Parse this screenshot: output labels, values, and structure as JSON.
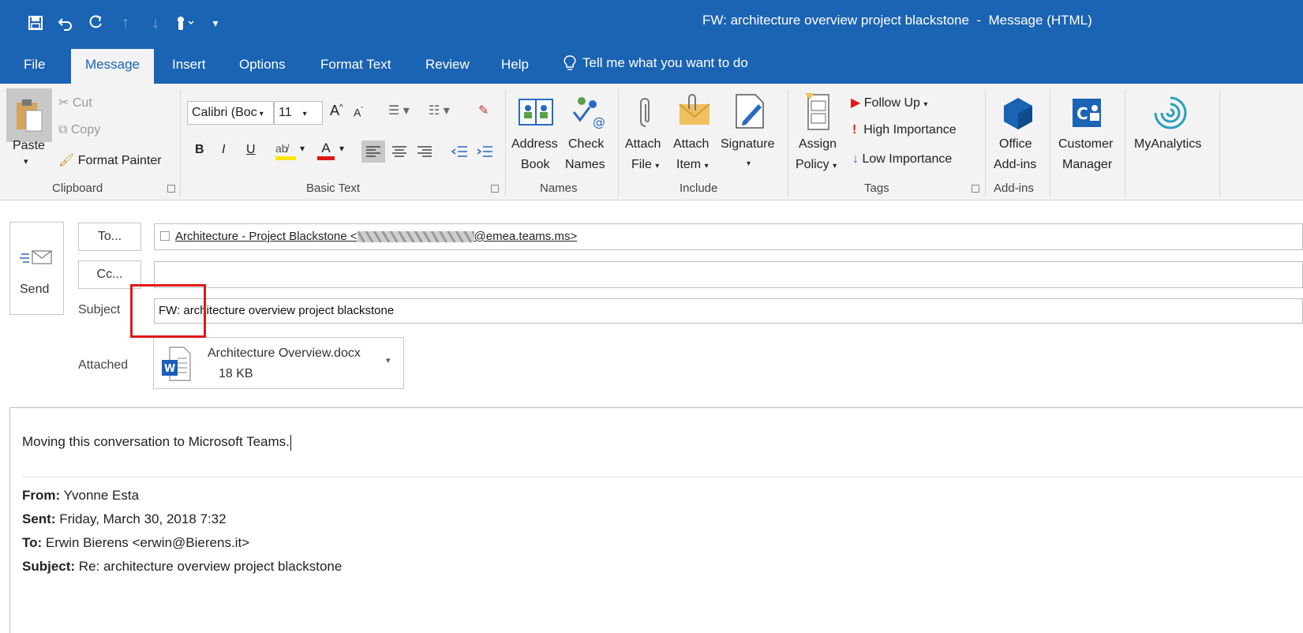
{
  "window": {
    "title": "FW: architecture overview project blackstone  -  Message (HTML)"
  },
  "qat": [
    "save-icon",
    "undo-icon",
    "redo-icon",
    "up-arrow-icon",
    "down-arrow-icon",
    "touch-mode-icon",
    "customize-icon"
  ],
  "tabs": [
    "File",
    "Message",
    "Insert",
    "Options",
    "Format Text",
    "Review",
    "Help"
  ],
  "tell_me": "Tell me what you want to do",
  "ribbon": {
    "clipboard": {
      "label": "Clipboard",
      "paste": "Paste",
      "cut": "Cut",
      "copy": "Copy",
      "format_painter": "Format Painter"
    },
    "basic_text": {
      "label": "Basic Text",
      "font": "Calibri (Boc",
      "size": "11"
    },
    "names": {
      "label": "Names",
      "address_book_1": "Address",
      "address_book_2": "Book",
      "check_names_1": "Check",
      "check_names_2": "Names"
    },
    "include": {
      "label": "Include",
      "attach_file_1": "Attach",
      "attach_file_2": "File",
      "attach_item_1": "Attach",
      "attach_item_2": "Item",
      "signature": "Signature"
    },
    "tags": {
      "label": "Tags",
      "assign_1": "Assign",
      "assign_2": "Policy",
      "follow_up": "Follow Up",
      "high": "High Importance",
      "low": "Low Importance"
    },
    "addins": {
      "label": "Add-ins",
      "office_1": "Office",
      "office_2": "Add-ins",
      "customer_1": "Customer",
      "customer_2": "Manager",
      "myanalytics": "MyAnalytics"
    }
  },
  "compose": {
    "send": "Send",
    "to_button": "To...",
    "cc_button": "Cc...",
    "to_value_prefix": "Architecture - Project Blackstone <",
    "to_value_suffix": "@emea.teams.ms>",
    "cc_value": "",
    "subject_label": "Subject",
    "subject_value": "FW: architecture overview project blackstone",
    "attached_label": "Attached",
    "attachment_name": "Architecture Overview.docx",
    "attachment_size": "18 KB"
  },
  "body": {
    "message": "Moving this conversation to Microsoft Teams.",
    "from_label": "From:",
    "from_value": " Yvonne Esta",
    "sent_label": "Sent:",
    "sent_value": " Friday, March 30, 2018 7:32",
    "to_label": "To:",
    "to_value": " Erwin Bierens <erwin@Bierens.it>",
    "subject_label": "Subject:",
    "subject_value": " Re: architecture overview project blackstone"
  },
  "colors": {
    "title_bar": "#1b63b3",
    "ribbon_bg": "#f3f3f3",
    "highlight_box": "#e01818"
  }
}
